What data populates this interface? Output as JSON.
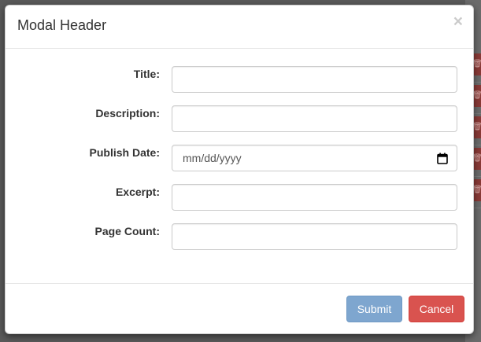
{
  "modal": {
    "title": "Modal Header",
    "close_symbol": "×"
  },
  "form": {
    "fields": [
      {
        "label": "Title:",
        "value": ""
      },
      {
        "label": "Description:",
        "value": ""
      },
      {
        "label": "Publish Date:",
        "placeholder": "mm/dd/yyyy"
      },
      {
        "label": "Excerpt:",
        "value": ""
      },
      {
        "label": "Page Count:",
        "value": ""
      }
    ]
  },
  "footer": {
    "submit_label": "Submit",
    "cancel_label": "Cancel"
  },
  "icons": {
    "close": "close-icon",
    "calendar": "calendar-icon",
    "trash": "trash-icon"
  },
  "colors": {
    "submit": "#7ea6cf",
    "cancel": "#d9534f",
    "backdrop": "#5a5a5a"
  }
}
